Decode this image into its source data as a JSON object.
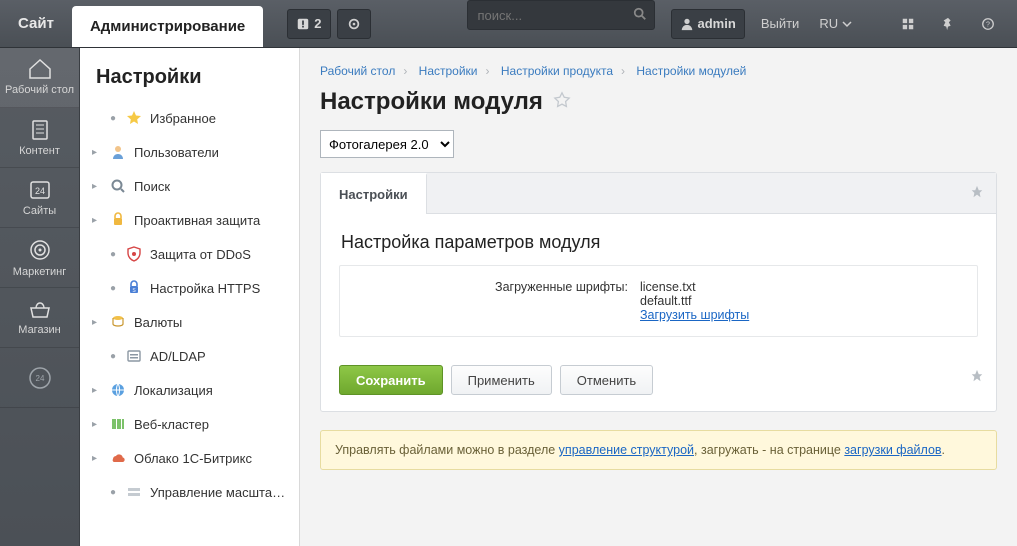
{
  "topbar": {
    "site_tab": "Сайт",
    "admin_tab": "Администрирование",
    "notif_count": "2",
    "search_placeholder": "поиск...",
    "user_name": "admin",
    "logout": "Выйти",
    "lang": "RU"
  },
  "rail": [
    {
      "label": "Рабочий стол"
    },
    {
      "label": "Контент"
    },
    {
      "label": "Сайты"
    },
    {
      "label": "Маркетинг"
    },
    {
      "label": "Магазин"
    },
    {
      "label": ""
    }
  ],
  "tree": {
    "title": "Настройки",
    "items": [
      {
        "label": "Избранное",
        "expandable": false
      },
      {
        "label": "Пользователи",
        "expandable": true
      },
      {
        "label": "Поиск",
        "expandable": true
      },
      {
        "label": "Проактивная защита",
        "expandable": true
      },
      {
        "label": "Защита от DDoS",
        "expandable": false
      },
      {
        "label": "Настройка HTTPS",
        "expandable": false
      },
      {
        "label": "Валюты",
        "expandable": true
      },
      {
        "label": "AD/LDAP",
        "expandable": false
      },
      {
        "label": "Локализация",
        "expandable": true
      },
      {
        "label": "Веб-кластер",
        "expandable": true
      },
      {
        "label": "Облако 1С-Битрикс",
        "expandable": true
      },
      {
        "label": "Управление масштабирова",
        "expandable": false
      }
    ]
  },
  "breadcrumbs": [
    "Рабочий стол",
    "Настройки",
    "Настройки продукта",
    "Настройки модулей"
  ],
  "page_title": "Настройки модуля",
  "module_selected": "Фотогалерея 2.0",
  "tab_label": "Настройки",
  "section_title": "Настройка параметров модуля",
  "form": {
    "label": "Загруженные шрифты:",
    "file1": "license.txt",
    "file2": "default.ttf",
    "upload_link": "Загрузить шрифты"
  },
  "buttons": {
    "save": "Сохранить",
    "apply": "Применить",
    "cancel": "Отменить"
  },
  "infobar": {
    "t1": "Управлять файлами можно в разделе ",
    "link1": "управление структурой",
    "t2": ", загружать - на странице ",
    "link2": "загрузки файлов",
    "t3": "."
  }
}
